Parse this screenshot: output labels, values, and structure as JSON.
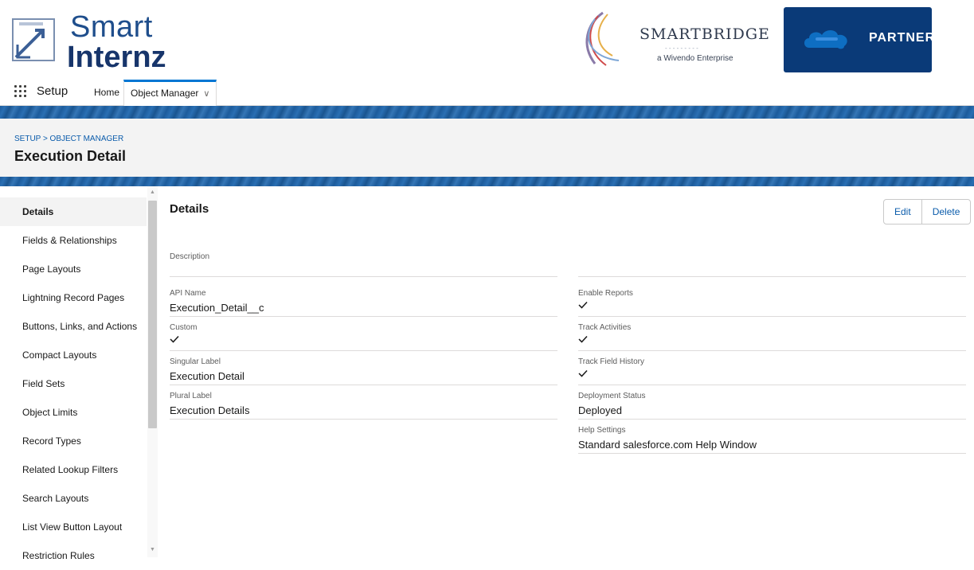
{
  "brand": {
    "smart_internz_line1": "Smart",
    "smart_internz_line2": "Internz",
    "smartbridge_name": "SMARTBRIDGE",
    "smartbridge_subtitle": "a Wivendo Enterprise",
    "partner_label": "PARTNER"
  },
  "nav": {
    "app_launcher_icon": "app-launcher-grid-icon",
    "app_name": "Setup",
    "tabs": [
      {
        "label": "Home",
        "active": false
      },
      {
        "label": "Object Manager",
        "active": true
      }
    ]
  },
  "header": {
    "breadcrumb": "SETUP > OBJECT MANAGER",
    "title": "Execution Detail"
  },
  "sidebar": {
    "items": [
      {
        "label": "Details",
        "active": true
      },
      {
        "label": "Fields & Relationships"
      },
      {
        "label": "Page Layouts"
      },
      {
        "label": "Lightning Record Pages"
      },
      {
        "label": "Buttons, Links, and Actions"
      },
      {
        "label": "Compact Layouts"
      },
      {
        "label": "Field Sets"
      },
      {
        "label": "Object Limits"
      },
      {
        "label": "Record Types"
      },
      {
        "label": "Related Lookup Filters"
      },
      {
        "label": "Search Layouts"
      },
      {
        "label": "List View Button Layout"
      },
      {
        "label": "Restriction Rules"
      }
    ]
  },
  "details": {
    "section_title": "Details",
    "edit_label": "Edit",
    "delete_label": "Delete",
    "description_label": "Description",
    "left": [
      {
        "label": "API Name",
        "value": "Execution_Detail__c"
      },
      {
        "label": "Custom",
        "value": "checked"
      },
      {
        "label": "Singular Label",
        "value": "Execution Detail"
      },
      {
        "label": "Plural Label",
        "value": "Execution Details"
      }
    ],
    "right": [
      {
        "label": "Enable Reports",
        "value": "checked"
      },
      {
        "label": "Track Activities",
        "value": "checked"
      },
      {
        "label": "Track Field History",
        "value": "checked"
      },
      {
        "label": "Deployment Status",
        "value": "Deployed"
      },
      {
        "label": "Help Settings",
        "value": "Standard salesforce.com Help Window"
      }
    ]
  },
  "colors": {
    "link": "#0b5cab",
    "accent": "#0176d3",
    "partner_bg": "#0a3a78"
  }
}
